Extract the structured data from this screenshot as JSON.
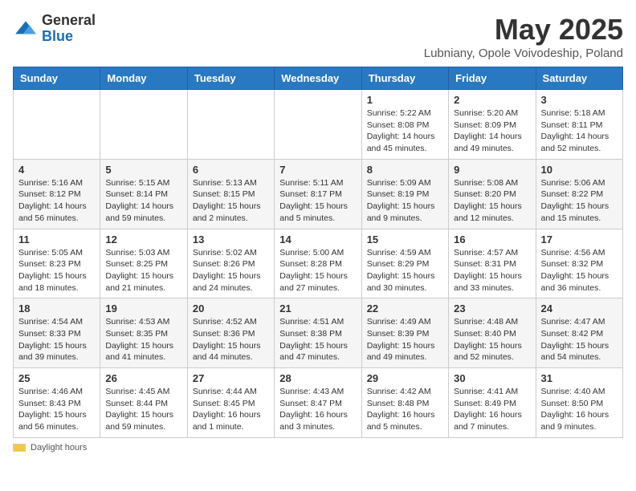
{
  "logo": {
    "general": "General",
    "blue": "Blue"
  },
  "title": "May 2025",
  "location": "Lubniany, Opole Voivodeship, Poland",
  "headers": [
    "Sunday",
    "Monday",
    "Tuesday",
    "Wednesday",
    "Thursday",
    "Friday",
    "Saturday"
  ],
  "footer": {
    "daylight_label": "Daylight hours"
  },
  "weeks": [
    [
      {
        "day": "",
        "info": ""
      },
      {
        "day": "",
        "info": ""
      },
      {
        "day": "",
        "info": ""
      },
      {
        "day": "",
        "info": ""
      },
      {
        "day": "1",
        "info": "Sunrise: 5:22 AM\nSunset: 8:08 PM\nDaylight: 14 hours and 45 minutes."
      },
      {
        "day": "2",
        "info": "Sunrise: 5:20 AM\nSunset: 8:09 PM\nDaylight: 14 hours and 49 minutes."
      },
      {
        "day": "3",
        "info": "Sunrise: 5:18 AM\nSunset: 8:11 PM\nDaylight: 14 hours and 52 minutes."
      }
    ],
    [
      {
        "day": "4",
        "info": "Sunrise: 5:16 AM\nSunset: 8:12 PM\nDaylight: 14 hours and 56 minutes."
      },
      {
        "day": "5",
        "info": "Sunrise: 5:15 AM\nSunset: 8:14 PM\nDaylight: 14 hours and 59 minutes."
      },
      {
        "day": "6",
        "info": "Sunrise: 5:13 AM\nSunset: 8:15 PM\nDaylight: 15 hours and 2 minutes."
      },
      {
        "day": "7",
        "info": "Sunrise: 5:11 AM\nSunset: 8:17 PM\nDaylight: 15 hours and 5 minutes."
      },
      {
        "day": "8",
        "info": "Sunrise: 5:09 AM\nSunset: 8:19 PM\nDaylight: 15 hours and 9 minutes."
      },
      {
        "day": "9",
        "info": "Sunrise: 5:08 AM\nSunset: 8:20 PM\nDaylight: 15 hours and 12 minutes."
      },
      {
        "day": "10",
        "info": "Sunrise: 5:06 AM\nSunset: 8:22 PM\nDaylight: 15 hours and 15 minutes."
      }
    ],
    [
      {
        "day": "11",
        "info": "Sunrise: 5:05 AM\nSunset: 8:23 PM\nDaylight: 15 hours and 18 minutes."
      },
      {
        "day": "12",
        "info": "Sunrise: 5:03 AM\nSunset: 8:25 PM\nDaylight: 15 hours and 21 minutes."
      },
      {
        "day": "13",
        "info": "Sunrise: 5:02 AM\nSunset: 8:26 PM\nDaylight: 15 hours and 24 minutes."
      },
      {
        "day": "14",
        "info": "Sunrise: 5:00 AM\nSunset: 8:28 PM\nDaylight: 15 hours and 27 minutes."
      },
      {
        "day": "15",
        "info": "Sunrise: 4:59 AM\nSunset: 8:29 PM\nDaylight: 15 hours and 30 minutes."
      },
      {
        "day": "16",
        "info": "Sunrise: 4:57 AM\nSunset: 8:31 PM\nDaylight: 15 hours and 33 minutes."
      },
      {
        "day": "17",
        "info": "Sunrise: 4:56 AM\nSunset: 8:32 PM\nDaylight: 15 hours and 36 minutes."
      }
    ],
    [
      {
        "day": "18",
        "info": "Sunrise: 4:54 AM\nSunset: 8:33 PM\nDaylight: 15 hours and 39 minutes."
      },
      {
        "day": "19",
        "info": "Sunrise: 4:53 AM\nSunset: 8:35 PM\nDaylight: 15 hours and 41 minutes."
      },
      {
        "day": "20",
        "info": "Sunrise: 4:52 AM\nSunset: 8:36 PM\nDaylight: 15 hours and 44 minutes."
      },
      {
        "day": "21",
        "info": "Sunrise: 4:51 AM\nSunset: 8:38 PM\nDaylight: 15 hours and 47 minutes."
      },
      {
        "day": "22",
        "info": "Sunrise: 4:49 AM\nSunset: 8:39 PM\nDaylight: 15 hours and 49 minutes."
      },
      {
        "day": "23",
        "info": "Sunrise: 4:48 AM\nSunset: 8:40 PM\nDaylight: 15 hours and 52 minutes."
      },
      {
        "day": "24",
        "info": "Sunrise: 4:47 AM\nSunset: 8:42 PM\nDaylight: 15 hours and 54 minutes."
      }
    ],
    [
      {
        "day": "25",
        "info": "Sunrise: 4:46 AM\nSunset: 8:43 PM\nDaylight: 15 hours and 56 minutes."
      },
      {
        "day": "26",
        "info": "Sunrise: 4:45 AM\nSunset: 8:44 PM\nDaylight: 15 hours and 59 minutes."
      },
      {
        "day": "27",
        "info": "Sunrise: 4:44 AM\nSunset: 8:45 PM\nDaylight: 16 hours and 1 minute."
      },
      {
        "day": "28",
        "info": "Sunrise: 4:43 AM\nSunset: 8:47 PM\nDaylight: 16 hours and 3 minutes."
      },
      {
        "day": "29",
        "info": "Sunrise: 4:42 AM\nSunset: 8:48 PM\nDaylight: 16 hours and 5 minutes."
      },
      {
        "day": "30",
        "info": "Sunrise: 4:41 AM\nSunset: 8:49 PM\nDaylight: 16 hours and 7 minutes."
      },
      {
        "day": "31",
        "info": "Sunrise: 4:40 AM\nSunset: 8:50 PM\nDaylight: 16 hours and 9 minutes."
      }
    ]
  ]
}
